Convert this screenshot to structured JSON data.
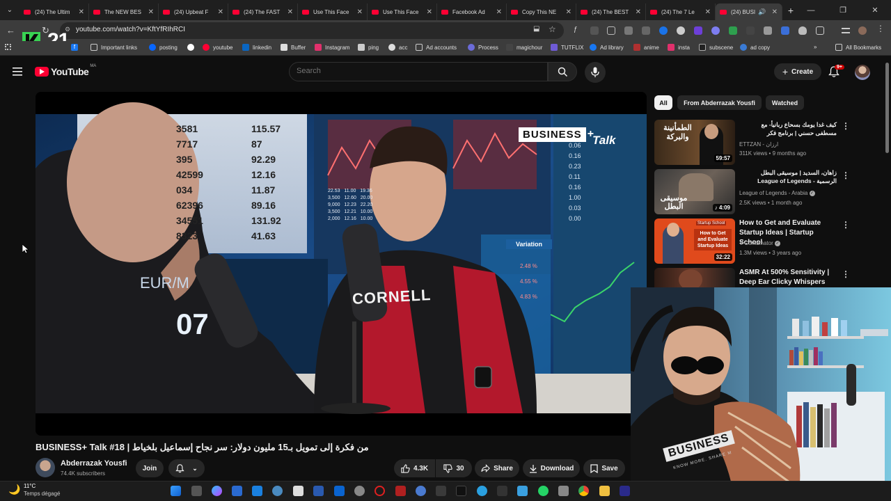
{
  "browser": {
    "tabs": [
      {
        "title": "(24) The Ultim"
      },
      {
        "title": "The NEW BES"
      },
      {
        "title": "(24) Upbeat F"
      },
      {
        "title": "(24) The FAST"
      },
      {
        "title": "Use This Face"
      },
      {
        "title": "Use This Face"
      },
      {
        "title": "Facebook Ad"
      },
      {
        "title": "Copy This NE"
      },
      {
        "title": "(24) The BEST"
      },
      {
        "title": "(24) The 7 Le"
      },
      {
        "title": "(24) BUSI"
      }
    ],
    "url": "youtube.com/watch?v=KftYfRIhRCI",
    "bookmarks": [
      "Important links",
      "posting",
      "youtube",
      "linkedin",
      "Buffer",
      "Instagram",
      "ping",
      "acc",
      "Ad accounts",
      "Process",
      "magichour",
      "TUTFLIX",
      "Ad library",
      "anime",
      "insta",
      "subscene",
      "ad copy"
    ],
    "all_bookmarks": "All Bookmarks",
    "badge_count": "7"
  },
  "overlay": {
    "logo_text": "21"
  },
  "youtube": {
    "logo": "YouTube",
    "country": "MA",
    "search_placeholder": "Search",
    "create_label": "Create",
    "notif_count": "9+"
  },
  "player": {
    "brand": "BUSINESS",
    "brand_talk": "Talk",
    "ticker_numbers": [
      "3581",
      "7717",
      "395",
      "42599",
      "034",
      "62396",
      "34551",
      "8323"
    ],
    "ticker_values": [
      "115.57",
      "87",
      "92.29",
      "12.16",
      "11.87",
      "89.16",
      "131.92",
      "41.63"
    ],
    "right_numbers": [
      "0.06",
      "0.16",
      "0.23",
      "0.11",
      "0.16",
      "1.00",
      "0.03",
      "0.00"
    ],
    "small_grid": [
      [
        "22.53",
        "11.00",
        "19.36"
      ],
      [
        "3,500",
        "12.60",
        "20.00"
      ],
      [
        "9,000",
        "12.23",
        "22.20"
      ],
      [
        "3,500",
        "12.21",
        "10.00"
      ],
      [
        "2,000",
        "12.16",
        "10.00"
      ]
    ],
    "variation_label": "Variation",
    "variation_values": [
      "2.48 %",
      "4.55 %",
      "4.83 %"
    ],
    "currency": "EUR/M",
    "big_number": "07",
    "hoodie_text": "CORNELL"
  },
  "video": {
    "title": "BUSINESS+ Talk #18 | من فكرة إلى تمويل بـ15 مليون دولار: سر نجاح إسماعيل بلخياط",
    "channel": "Abderrazak Yousfi",
    "subscribers": "74.4K subscribers",
    "join_label": "Join",
    "likes": "4.3K",
    "dislikes": "30",
    "share_label": "Share",
    "download_label": "Download",
    "save_label": "Save"
  },
  "sidebar": {
    "chips": [
      "All",
      "From Abderrazak Yousfi",
      "Watched"
    ],
    "recommendations": [
      {
        "title": "كيف غدا يومك بسحاع ربانيأ- مع مسطفى حسني | برنامج فكر",
        "channel": "ETTZAN - ارزان",
        "meta": "311K views • 9 months ago",
        "duration": "59:57",
        "thumb_text": "الطمأنينة والبركة",
        "verified": false
      },
      {
        "title": "زاهان، السديد | موسيقى البطل الرسمية - League of Legends",
        "channel": "League of Legends - Arabia",
        "meta": "2.5K views • 1 month ago",
        "duration": "4:09",
        "thumb_text": "موسيقى البطل",
        "verified": true
      },
      {
        "title": "How to Get and Evaluate Startup Ideas | Startup School",
        "channel": "Y Combinator",
        "meta": "1.3M views • 3 years ago",
        "duration": "32:22",
        "thumb_text": "How to Get and Evaluate Startup Ideas",
        "thumb_header": "Startup School",
        "verified": true
      },
      {
        "title": "ASMR At 500% Sensitivity | Deep Ear Clicky Whispers",
        "channel": "",
        "meta": "",
        "duration": "",
        "thumb_text": "",
        "verified": false
      }
    ]
  },
  "webcam": {
    "shirt_text": "BUSINESS",
    "shirt_sub": "KNOW MORE. SHARE M"
  },
  "taskbar": {
    "temp": "11°C",
    "weather": "Temps dégagé"
  }
}
